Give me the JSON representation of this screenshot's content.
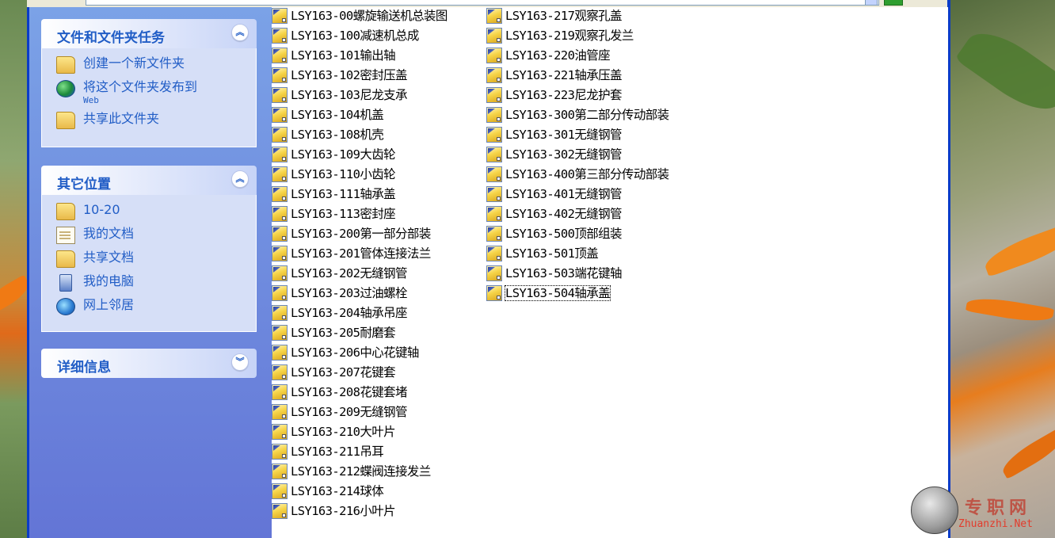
{
  "task_pane": {
    "file_tasks": {
      "title": "文件和文件夹任务",
      "toggle": "«",
      "items": [
        {
          "label": "创建一个新文件夹",
          "icon": "new-folder-icon"
        },
        {
          "label": "将这个文件夹发布到",
          "sublabel": "Web",
          "icon": "publish-web-icon"
        },
        {
          "label": "共享此文件夹",
          "icon": "share-folder-icon"
        }
      ]
    },
    "other_places": {
      "title": "其它位置",
      "toggle": "«",
      "items": [
        {
          "label": "10-20",
          "icon": "folder-icon"
        },
        {
          "label": "我的文档",
          "icon": "my-documents-icon"
        },
        {
          "label": "共享文档",
          "icon": "shared-documents-icon"
        },
        {
          "label": "我的电脑",
          "icon": "my-computer-icon"
        },
        {
          "label": "网上邻居",
          "icon": "network-places-icon"
        }
      ]
    },
    "details": {
      "title": "详细信息",
      "toggle": "»"
    }
  },
  "files_col1": [
    "LSY163-00螺旋输送机总装图",
    "LSY163-100减速机总成",
    "LSY163-101输出轴",
    "LSY163-102密封压盖",
    "LSY163-103尼龙支承",
    "LSY163-104机盖",
    "LSY163-108机壳",
    "LSY163-109大齿轮",
    "LSY163-110小齿轮",
    "LSY163-111轴承盖",
    "LSY163-113密封座",
    "LSY163-200第一部分部装",
    "LSY163-201管体连接法兰",
    "LSY163-202无缝钢管",
    "LSY163-203过油螺栓",
    "LSY163-204轴承吊座",
    "LSY163-205耐磨套",
    "LSY163-206中心花键轴",
    "LSY163-207花键套",
    "LSY163-208花键套堵",
    "LSY163-209无缝钢管",
    "LSY163-210大叶片",
    "LSY163-211吊耳",
    "LSY163-212蝶阀连接发兰",
    "LSY163-214球体",
    "LSY163-216小叶片"
  ],
  "files_col2": [
    "LSY163-217观察孔盖",
    "LSY163-219观察孔发兰",
    "LSY163-220油管座",
    "LSY163-221轴承压盖",
    "LSY163-223尼龙护套",
    "LSY163-300第二部分传动部装",
    "LSY163-301无缝钢管",
    "LSY163-302无缝钢管",
    "LSY163-400第三部分传动部装",
    "LSY163-401无缝钢管",
    "LSY163-402无缝钢管",
    "LSY163-500顶部组装",
    "LSY163-501顶盖",
    "LSY163-503端花键轴",
    "LSY163-504轴承盖"
  ],
  "selected_file": "LSY163-504轴承盖",
  "watermark": {
    "text": "专职网",
    "url": "Zhuanzhi.Net"
  }
}
